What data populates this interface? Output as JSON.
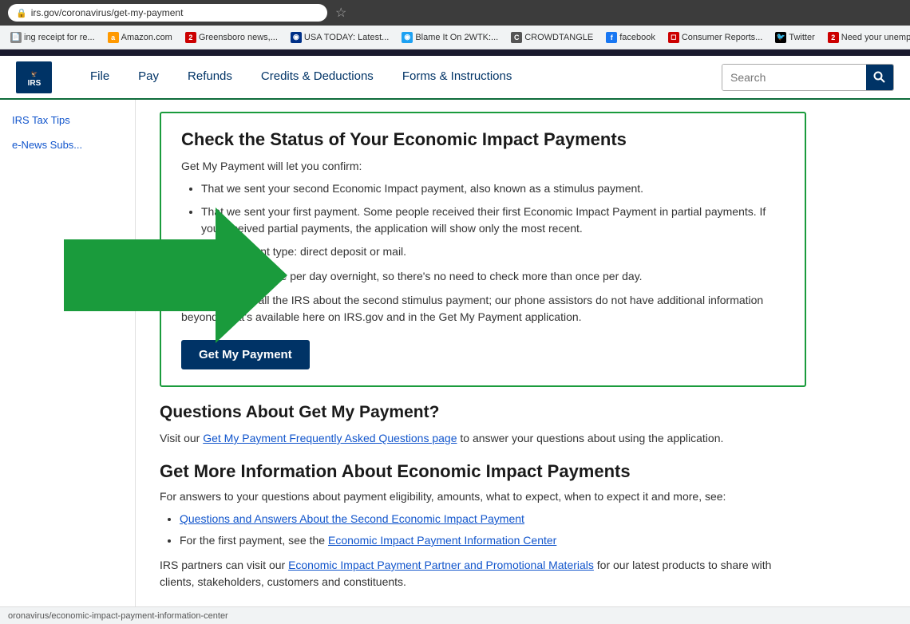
{
  "browser": {
    "address": "irs.gov/coronavirus/get-my-payment",
    "bookmarks": [
      {
        "label": "ing receipt for re...",
        "favicon": "receipt",
        "icon_char": "📄"
      },
      {
        "label": "Amazon.com",
        "favicon": "amazon",
        "icon_char": "a"
      },
      {
        "label": "Greensboro news,...",
        "favicon": "news",
        "icon_char": "2"
      },
      {
        "label": "USA TODAY: Latest...",
        "favicon": "usa",
        "icon_char": "◉"
      },
      {
        "label": "Blame It On 2WTK:...",
        "favicon": "blame",
        "icon_char": "◉"
      },
      {
        "label": "CROWDTANGLE",
        "favicon": "crowd",
        "icon_char": "C"
      },
      {
        "label": "facebook",
        "favicon": "fb",
        "icon_char": "f"
      },
      {
        "label": "Consumer Reports...",
        "favicon": "cr",
        "icon_char": "◻"
      },
      {
        "label": "Twitter",
        "favicon": "twitter",
        "icon_char": "🐦"
      },
      {
        "label": "Need your unempl...",
        "favicon": "need",
        "icon_char": "2"
      }
    ]
  },
  "header": {
    "logo_text": "IRS",
    "logo_subtext": "☆☆☆",
    "nav_items": [
      "File",
      "Pay",
      "Refunds",
      "Credits & Deductions",
      "Forms & Instructions"
    ],
    "search_placeholder": "Search"
  },
  "sidebar": {
    "items": [
      "IRS Tax Tips",
      "e-News Subs..."
    ]
  },
  "main": {
    "status_box": {
      "title": "Check the Status of Your Economic Impact Payments",
      "confirm_label": "Get My Payment will let you confirm:",
      "bullets": [
        "That we sent your second Economic Impact payment, also known as a stimulus payment.",
        "That we sent your first payment. Some people received their first Economic Impact Payment in partial payments. If you received partial payments, the application will show only the most recent.",
        "Your payment type: direct deposit or mail."
      ],
      "data_update": "Data is updated once per day overnight, so there's no need to check more than once per day.",
      "no_call": "Please do not call the IRS about the second stimulus payment; our phone assistors do not have additional information beyond what's available here on IRS.gov and in the Get My Payment application.",
      "button_label": "Get My Payment"
    },
    "questions_section": {
      "title": "Questions About Get My Payment?",
      "text_before_link": "Visit our ",
      "link_text": "Get My Payment Frequently Asked Questions page",
      "text_after_link": " to answer your questions about using the application."
    },
    "more_info_section": {
      "title": "Get More Information About Economic Impact Payments",
      "intro": "For answers to your questions about payment eligibility, amounts, what to expect, when to expect it and more, see:",
      "bullets": [
        {
          "text": "Questions and Answers About the Second Economic Impact Payment",
          "is_link": true
        },
        {
          "text_before": "For the first payment, see the ",
          "link_text": "Economic Impact Payment Information Center",
          "is_link": true
        }
      ],
      "partners_before": "IRS partners can visit our ",
      "partners_link": "Economic Impact Payment Partner and Promotional Materials",
      "partners_after": " for our latest products to share with clients, stakeholders, customers and constituents."
    }
  },
  "status_bar": {
    "url": "oronavirus/economic-impact-payment-information-center"
  }
}
